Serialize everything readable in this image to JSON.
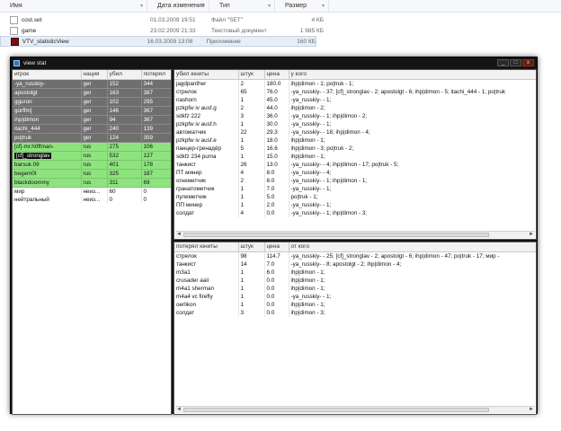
{
  "explorer": {
    "columns": {
      "name": "Имя",
      "date": "Дата изменения",
      "type": "Тип",
      "size": "Размер"
    },
    "files": [
      {
        "name": "cost.set",
        "date": "01.03.2009 19:51",
        "type": "Файл \"SET\"",
        "size": "4 КБ",
        "icon": "file-icon"
      },
      {
        "name": "game",
        "date": "23.02.2009 21:33",
        "type": "Текстовый документ",
        "size": "1 985 КБ",
        "icon": "file-icon"
      },
      {
        "name": "VTV_statisticView",
        "date": "16.03.2009 13:08",
        "type": "Приложение",
        "size": "160 КБ",
        "icon": "app-icon"
      }
    ]
  },
  "window": {
    "title": "view stat",
    "buttons": {
      "minimize": "_",
      "maximize": "□",
      "close": "x"
    }
  },
  "players": {
    "headers": [
      "игрок",
      "нация",
      "убил",
      "потерял"
    ],
    "rows": [
      {
        "player": "-ya_russkiy-",
        "nation": "ger",
        "killed": "152",
        "lost": "344",
        "style": "ger"
      },
      {
        "player": "apostolgt",
        "nation": "ger",
        "killed": "163",
        "lost": "387",
        "style": "ger"
      },
      {
        "player": "gguron",
        "nation": "ger",
        "killed": "102",
        "lost": "295",
        "style": "ger"
      },
      {
        "player": "gorffm]",
        "nation": "ger",
        "killed": "146",
        "lost": "367",
        "style": "ger"
      },
      {
        "player": "ihp|dimon",
        "nation": "ger",
        "killed": "94",
        "lost": "367",
        "style": "ger"
      },
      {
        "player": "itachi_444",
        "nation": "ger",
        "killed": "240",
        "lost": "139",
        "style": "ger"
      },
      {
        "player": "po|truk",
        "nation": "ger",
        "killed": "124",
        "lost": "359",
        "style": "ger"
      },
      {
        "player": "[cf]-mr.h0ffman-",
        "nation": "rus",
        "killed": "275",
        "lost": "106",
        "style": "rus"
      },
      {
        "player": "[cf]_stronglav",
        "nation": "rus",
        "killed": "532",
        "lost": "127",
        "style": "rus-sel"
      },
      {
        "player": "barsuk.09",
        "nation": "rus",
        "killed": "401",
        "lost": "178",
        "style": "rus"
      },
      {
        "player": "begem0t",
        "nation": "rus",
        "killed": "325",
        "lost": "187",
        "style": "rus"
      },
      {
        "player": "blackdoommy",
        "nation": "rus",
        "killed": "311",
        "lost": "69",
        "style": "rus"
      },
      {
        "player": "мир",
        "nation": "неиз...",
        "killed": "60",
        "lost": "0",
        "style": "plain"
      },
      {
        "player": "нейтральный",
        "nation": "неиз...",
        "killed": "0",
        "lost": "0",
        "style": "plain"
      }
    ]
  },
  "killed_units": {
    "headers": [
      "убил юниты",
      "штук",
      "цена",
      "у кого"
    ],
    "rows": [
      [
        "jagdpanther",
        "2",
        "180.0",
        "ihp|dimon - 1; po|truk - 1;"
      ],
      [
        "стрелок",
        "65",
        "76.0",
        "-ya_russkiy- - 37; [cf]_stronglav - 2; apostolgt - 6; ihp|dimon - 5; itachi_444 - 1; po|truk"
      ],
      [
        "nashorn",
        "1",
        "45.0",
        "-ya_russkiy- - 1;"
      ],
      [
        "pzkpfw iv ausf.g",
        "2",
        "44.0",
        "ihp|dimon - 2;"
      ],
      [
        "sdkfz 222",
        "3",
        "36.0",
        "-ya_russkiy- - 1; ihp|dimon - 2;"
      ],
      [
        "pzkpfw iv ausf.h",
        "1",
        "30.0",
        "-ya_russkiy- - 1;"
      ],
      [
        "автоматчик",
        "22",
        "29.3",
        "-ya_russkiy- - 18; ihp|dimon - 4;"
      ],
      [
        "pzkpfw iv ausf.e",
        "1",
        "18.0",
        "ihp|dimon - 1;"
      ],
      [
        "панцер-гренадёр",
        "5",
        "16.6",
        "ihp|dimon - 3; po|truk - 2;"
      ],
      [
        "sdkfz 234 puma",
        "1",
        "15.0",
        "ihp|dimon - 1;"
      ],
      [
        "танкист",
        "26",
        "13.0",
        "-ya_russkiy- - 4; ihp|dimon - 17; po|truk - 5;"
      ],
      [
        "ПТ минер",
        "4",
        "8.0",
        "-ya_russkiy- - 4;"
      ],
      [
        "огнеметчик",
        "2",
        "8.0",
        "-ya_russkiy- - 1; ihp|dimon - 1;"
      ],
      [
        "гранатометчик",
        "1",
        "7.0",
        "-ya_russkiy- - 1;"
      ],
      [
        "пулеметчик",
        "1",
        "5.0",
        "po|truk - 1;"
      ],
      [
        "ПП минер",
        "1",
        "2.0",
        "-ya_russkiy- - 1;"
      ],
      [
        "солдат",
        "4",
        "0.0",
        "-ya_russkiy- - 1; ihp|dimon - 3;"
      ]
    ]
  },
  "lost_units": {
    "headers": [
      "потерял юниты",
      "штук",
      "цена",
      "от кого"
    ],
    "rows": [
      [
        "стрелок",
        "98",
        "114.7",
        "-ya_russkiy- - 25; [cf]_stronglav - 2; apostolgt - 6; ihp|dimon - 47; po|truk - 17; мир -"
      ],
      [
        "танкист",
        "14",
        "7.0",
        "-ya_russkiy- - 8; apostolgt - 2; ihp|dimon - 4;"
      ],
      [
        "m3a1",
        "1",
        "6.0",
        "ihp|dimon - 1;"
      ],
      [
        "crusader aaii",
        "1",
        "0.0",
        "ihp|dimon - 1;"
      ],
      [
        "m4a1 sherman",
        "1",
        "0.0",
        "ihp|dimon - 1;"
      ],
      [
        "m4a4 vc firefly",
        "1",
        "0.0",
        "-ya_russkiy- - 1;"
      ],
      [
        "oerlikon",
        "1",
        "0.0",
        "ihp|dimon - 1;"
      ],
      [
        "солдат",
        "3",
        "0.0",
        "ihp|dimon - 3;"
      ]
    ]
  },
  "scroll": {
    "left": "◄",
    "right": "►"
  }
}
